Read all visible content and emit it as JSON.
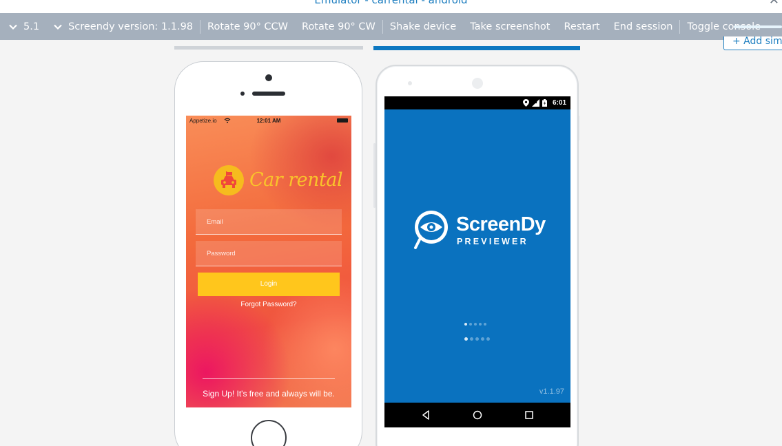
{
  "window": {
    "title": "Emulator - carrental - android",
    "close_icon": "close-icon"
  },
  "toolbar": {
    "android_version": "5.1",
    "screendy_version": "Screendy version: 1.1.98",
    "rotate_ccw": "Rotate 90° CCW",
    "rotate_cw": "Rotate 90° CW",
    "shake": "Shake device",
    "screenshot": "Take screenshot",
    "restart": "Restart",
    "end_session": "End session",
    "toggle_console": "Toggle console",
    "add_simulator": "+ Add sim"
  },
  "ios": {
    "status": {
      "carrier": "Appetize.io",
      "time": "12:01 AM"
    },
    "app": {
      "brand": "Car rental",
      "email_placeholder": "Email",
      "password_placeholder": "Password",
      "login_label": "Login",
      "forgot_label": "Forgot Password?",
      "signup_label": "Sign Up! It's free and always will be."
    }
  },
  "android": {
    "status": {
      "time": "6:01"
    },
    "splash": {
      "name": "ScreenDy",
      "subtitle": "PREVIEWER",
      "version": "v1.1.97"
    }
  },
  "colors": {
    "toolbar_bg": "#a5b0bd",
    "accent_blue": "#0d78c1",
    "login_yellow": "#ffc61c",
    "android_screen": "#0a72bf"
  }
}
